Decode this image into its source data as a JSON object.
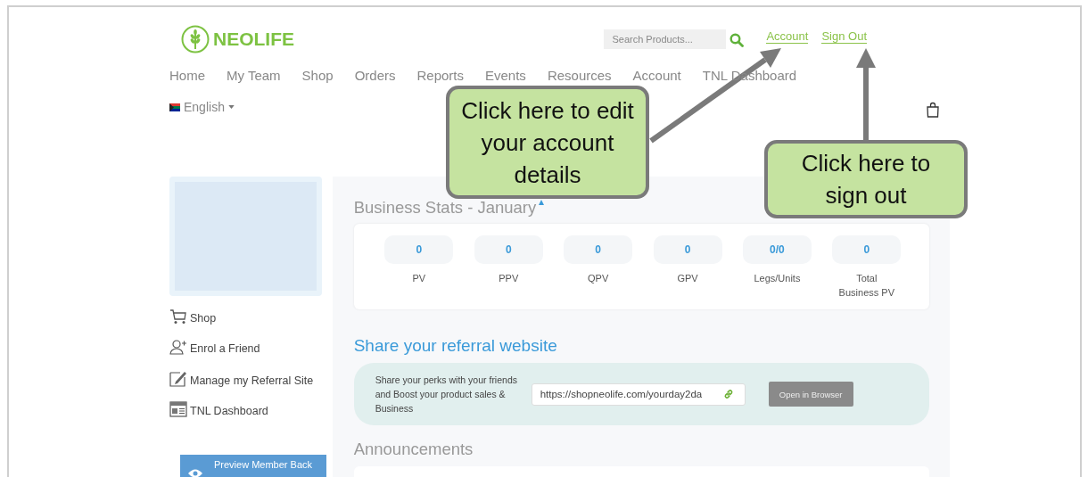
{
  "header": {
    "logo": "NEOLIFE",
    "search": {
      "placeholder": "Search Products..."
    },
    "top_links": [
      "Account",
      "Sign Out"
    ]
  },
  "nav": [
    "Home",
    "My Team",
    "Shop",
    "Orders",
    "Reports",
    "Events",
    "Resources",
    "Account",
    "TNL Dashboard"
  ],
  "language": "English",
  "sidebar": {
    "links": [
      {
        "kind": "cart",
        "label": "Shop"
      },
      {
        "kind": "person-add",
        "label": "Enrol a Friend"
      },
      {
        "kind": "edit",
        "label": "Manage my Referral Site"
      },
      {
        "kind": "dashboard",
        "label": "TNL Dashboard"
      }
    ],
    "preview_button": "Preview Member Back"
  },
  "business_stats": {
    "title": "Business Stats - January",
    "stats": [
      {
        "value": "0",
        "label": "PV"
      },
      {
        "value": "0",
        "label": "PPV"
      },
      {
        "value": "0",
        "label": "QPV"
      },
      {
        "value": "0",
        "label": "GPV"
      },
      {
        "value": "0/0",
        "label": "Legs/Units"
      },
      {
        "value": "0",
        "label": "Total Business PV"
      }
    ]
  },
  "referral": {
    "title": "Share your referral website",
    "text": "Share your perks with your friends and Boost your product sales & Business",
    "url": "https://shopneolife.com/yourday2da",
    "button": "Open in Browser"
  },
  "announcements": {
    "title": "Announcements"
  },
  "callouts": [
    {
      "text": "Click here to edit your account details"
    },
    {
      "text": "Click here to sign out"
    }
  ]
}
